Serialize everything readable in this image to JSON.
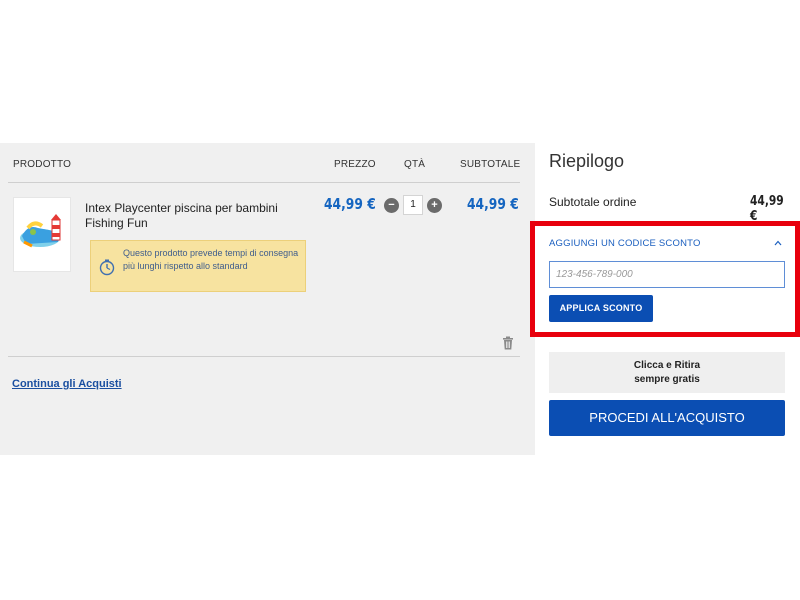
{
  "cart": {
    "headers": {
      "product": "PRODOTTO",
      "price": "PREZZO",
      "qty": "QTÀ",
      "subtotal": "SUBTOTALE"
    },
    "items": [
      {
        "name": "Intex Playcenter piscina per bambini Fishing Fun",
        "price": "44,99 €",
        "quantity": "1",
        "subtotal": "44,99 €",
        "notice": "Questo prodotto prevede tempi di consegna più lunghi rispetto allo standard"
      }
    ],
    "continue_link": "Continua gli Acquisti"
  },
  "summary": {
    "title": "Riepilogo",
    "subtotal_label": "Subtotale ordine",
    "subtotal_value": "44,99 €",
    "coupon": {
      "toggle_label": "AGGIUNGI UN CODICE SCONTO",
      "placeholder": "123-456-789-000",
      "apply_label": "APPLICA SCONTO"
    },
    "pickup_line1": "Clicca e Ritira",
    "pickup_line2": "sempre gratis",
    "checkout_label": "PROCEDI ALL'ACQUISTO"
  },
  "colors": {
    "accent": "#0b4eb3",
    "price": "#1565c0",
    "highlight": "#e8000d",
    "notice_bg": "#f7e3a0"
  }
}
